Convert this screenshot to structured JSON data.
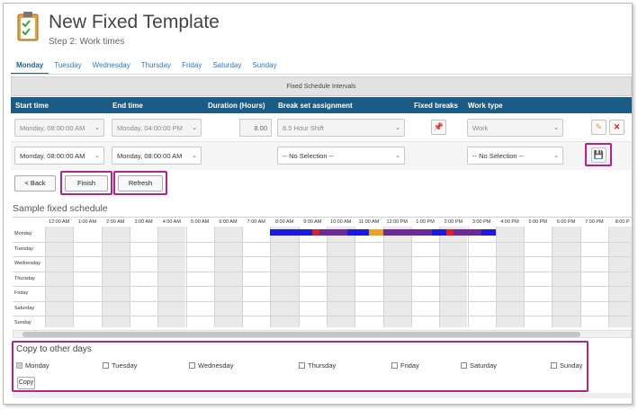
{
  "header": {
    "title": "New Fixed Template",
    "subtitle": "Step 2: Work times"
  },
  "tabs": [
    "Monday",
    "Tuesday",
    "Wednesday",
    "Thursday",
    "Friday",
    "Saturday",
    "Sunday"
  ],
  "intervals": {
    "panel_title": "Fixed Schedule Intervals",
    "columns": {
      "start_time": "Start time",
      "end_time": "End time",
      "duration": "Duration (Hours)",
      "break_set": "Break set assignment",
      "fixed_breaks": "Fixed breaks",
      "work_type": "Work type"
    },
    "row1": {
      "start": "Monday, 08:00:00 AM",
      "end": "Monday, 04:00:00 PM",
      "duration": "8.00",
      "break_set": "8.5 Hour Shift",
      "work_type": "Work"
    },
    "row2": {
      "start": "Monday, 08:00:00 AM",
      "end": "Monday, 08:00:00 AM",
      "break_set": "-- No Selection --",
      "work_type": "-- No Selection --"
    }
  },
  "buttons": {
    "back": "< Back",
    "finish": "Finish",
    "refresh": "Refresh",
    "copy": "Copy"
  },
  "sample": {
    "title": "Sample fixed schedule",
    "hours": [
      "12:00 AM",
      "1:00 AM",
      "2:00 AM",
      "3:00 AM",
      "4:00 AM",
      "5:00 AM",
      "6:00 AM",
      "7:00 AM",
      "8:00 AM",
      "9:00 AM",
      "10:00 AM",
      "11:00 AM",
      "12:00 PM",
      "1:00 PM",
      "2:00 PM",
      "3:00 PM",
      "4:00 PM",
      "5:00 PM",
      "6:00 PM",
      "7:00 PM",
      "8:00 P"
    ],
    "days": [
      "Monday",
      "Tuesday",
      "Wednesday",
      "Thursday",
      "Friday",
      "Saturday",
      "Sunday"
    ]
  },
  "copy": {
    "title": "Copy to other days",
    "days": [
      "Monday",
      "Tuesday",
      "Wednesday",
      "Thursday",
      "Friday",
      "Saturday",
      "Sunday"
    ]
  },
  "colors": {
    "accent": "#1a5c85",
    "highlight": "#b7218b",
    "work": "#1a1ae0",
    "break": "#6a2a9a",
    "meal": "#f0a020",
    "red": "#e02020"
  }
}
